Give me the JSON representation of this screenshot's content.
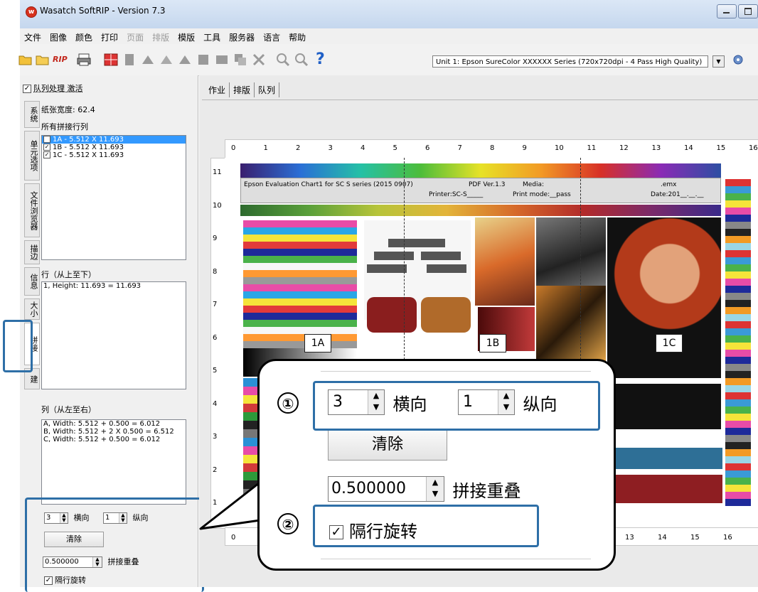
{
  "window": {
    "title": "Wasatch SoftRIP - Version 7.3"
  },
  "menu": [
    {
      "label": "文件",
      "enabled": true
    },
    {
      "label": "图像",
      "enabled": true
    },
    {
      "label": "颜色",
      "enabled": true
    },
    {
      "label": "打印",
      "enabled": true
    },
    {
      "label": "页面",
      "enabled": false
    },
    {
      "label": "排版",
      "enabled": false
    },
    {
      "label": "模版",
      "enabled": true
    },
    {
      "label": "工具",
      "enabled": true
    },
    {
      "label": "服务器",
      "enabled": true
    },
    {
      "label": "语言",
      "enabled": true
    },
    {
      "label": "帮助",
      "enabled": true
    }
  ],
  "toolbar": {
    "rip_label": "RIP",
    "printer_select": "Unit 1: Epson  SureColor XXXXXX Series (720x720dpi - 4 Pass High Quality)"
  },
  "left": {
    "queue_active": "队列处理 激活",
    "paper_width": "纸张宽度: 62.4",
    "all_tile_rows": "所有拼接行列",
    "tiles": [
      "1A - 5.512 X 11.693",
      "1B - 5.512 X 11.693",
      "1C - 5.512 X 11.693"
    ],
    "vtabs": [
      "系统",
      "单元选项",
      "文件浏览器",
      "描边",
      "信息",
      "大小",
      "拼接",
      "建"
    ],
    "rows_label": "行（从上至下）",
    "rows": [
      "1, Height: 11.693 = 11.693"
    ],
    "cols_label": "列（从左至右）",
    "cols": [
      "A, Width: 5.512 + 0.500 = 6.012",
      "B, Width: 5.512 + 2 X 0.500 = 6.512",
      "C, Width: 5.512 + 0.500 = 6.012"
    ],
    "horiz_value": "3",
    "horiz_label": "横向",
    "vert_value": "1",
    "vert_label": "纵向",
    "clear_label": "清除",
    "overlap_value": "0.500000",
    "overlap_label": "拼接重叠",
    "rotate_label": "隔行旋转"
  },
  "tabs": [
    "作业",
    "排版",
    "队列"
  ],
  "ruler": {
    "top_ticks": [
      "0",
      "1",
      "2",
      "3",
      "4",
      "5",
      "6",
      "7",
      "8",
      "9",
      "10",
      "11",
      "12",
      "13",
      "14",
      "15",
      "16"
    ],
    "left_ticks": [
      "11",
      "10",
      "9",
      "8",
      "7",
      "6",
      "5",
      "4",
      "3",
      "2",
      "1"
    ],
    "bottom_ticks": [
      "0",
      "13",
      "14",
      "15",
      "16"
    ]
  },
  "chart": {
    "heading": "Epson Evaluation Chart1 for SC S series (2015 0907)",
    "pdf": "PDF Ver.1.3",
    "media": "Media:",
    "emx": ".emx",
    "printer": "Printer:SC-S_____",
    "mode": "Print mode:__pass",
    "date": "Date:201__.__.__"
  },
  "tile_labels": [
    "1A",
    "1B",
    "1C"
  ],
  "callout": {
    "horiz_value": "3",
    "horiz_label": "横向",
    "vert_value": "1",
    "vert_label": "纵向",
    "clear_label": "清除",
    "overlap_value": "0.500000",
    "overlap_label": "拼接重叠",
    "rotate_label": "隔行旋转",
    "marker1": "①",
    "marker2": "②"
  }
}
